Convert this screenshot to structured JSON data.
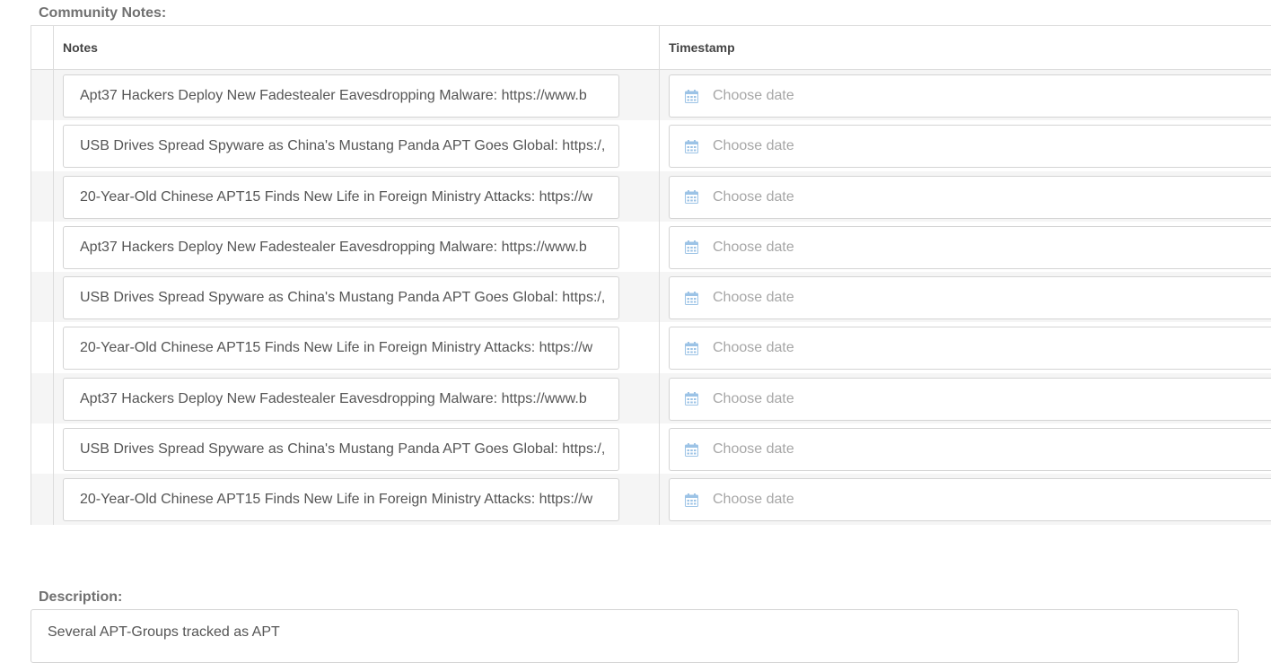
{
  "community_notes": {
    "label": "Community Notes:",
    "columns": {
      "notes": "Notes",
      "timestamp": "Timestamp"
    },
    "rows": [
      {
        "note": "Apt37 Hackers Deploy New Fadestealer Eavesdropping Malware: https://www.b",
        "timestamp_placeholder": "Choose date"
      },
      {
        "note": "USB Drives Spread Spyware as China's Mustang Panda APT Goes Global: https:/,",
        "timestamp_placeholder": "Choose date"
      },
      {
        "note": "20-Year-Old Chinese APT15 Finds New Life in Foreign Ministry Attacks: https://w",
        "timestamp_placeholder": "Choose date"
      },
      {
        "note": "Apt37 Hackers Deploy New Fadestealer Eavesdropping Malware: https://www.b",
        "timestamp_placeholder": "Choose date"
      },
      {
        "note": "USB Drives Spread Spyware as China's Mustang Panda APT Goes Global: https:/,",
        "timestamp_placeholder": "Choose date"
      },
      {
        "note": "20-Year-Old Chinese APT15 Finds New Life in Foreign Ministry Attacks: https://w",
        "timestamp_placeholder": "Choose date"
      },
      {
        "note": "Apt37 Hackers Deploy New Fadestealer Eavesdropping Malware: https://www.b",
        "timestamp_placeholder": "Choose date"
      },
      {
        "note": "USB Drives Spread Spyware as China's Mustang Panda APT Goes Global: https:/,",
        "timestamp_placeholder": "Choose date"
      },
      {
        "note": "20-Year-Old Chinese APT15 Finds New Life in Foreign Ministry Attacks: https://w",
        "timestamp_placeholder": "Choose date"
      }
    ]
  },
  "description": {
    "label": "Description:",
    "value": "Several APT-Groups tracked as APT"
  },
  "icons": {
    "date_field": "calendar-icon"
  },
  "colors": {
    "calendar_icon": "#9cc3e6",
    "row_stripe": "#f5f5f5",
    "border": "#dcdcdc"
  }
}
